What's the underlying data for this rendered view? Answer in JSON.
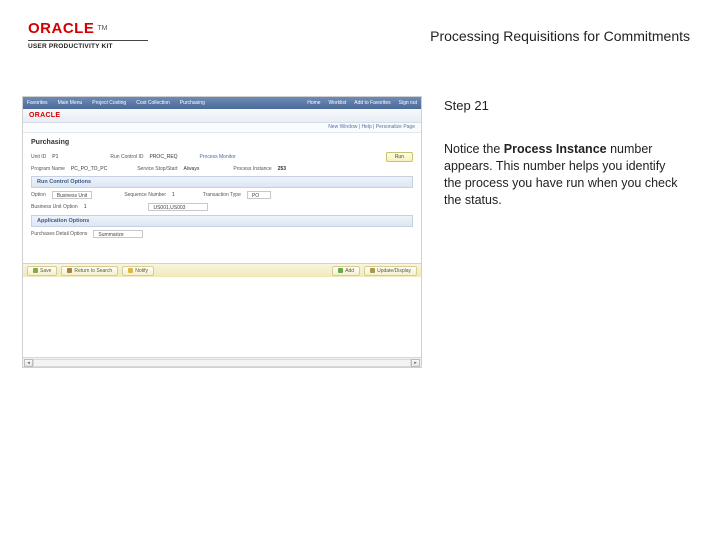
{
  "logo": {
    "brand": "ORACLE",
    "tm": "TM",
    "subtitle": "USER PRODUCTIVITY KIT"
  },
  "page_title": "Processing Requisitions for Commitments",
  "step_label": "Step 21",
  "instruction": {
    "pre": "Notice the ",
    "bold": "Process Instance",
    "post": " number appears. This number helps you identify the process you have run when you check the status."
  },
  "screenshot": {
    "menu": {
      "items": [
        "Favorites",
        "Main Menu",
        "Project Costing",
        "Cost Collection",
        "Purchasing"
      ],
      "right": [
        "Home",
        "Worklist",
        "Add to Favorites",
        "Sign out"
      ]
    },
    "oracle": "ORACLE",
    "crumbs": "New Window | Help | Personalize Page",
    "heading": "Purchasing",
    "row1": {
      "l1": "Unit ID",
      "v1": "P1",
      "l2": "Run Control ID",
      "v2": "PROC_REQ",
      "l3": "Process Monitor",
      "run": "Run"
    },
    "row2": {
      "l1": "Program Name",
      "v1": "PC_PO_TO_PC",
      "l2": "Service Stop/Start",
      "v2": "Always",
      "l3": "Process Instance",
      "v3": "253"
    },
    "group1": "Run Control Options",
    "opts": {
      "l1": "Option",
      "v1": "Business Unit",
      "l2": "Sequence Number",
      "v2": "1",
      "l3": "Transaction Type",
      "v3": "PO"
    },
    "opts2": {
      "l1": "Business Unit Option",
      "v1": "1",
      "l2": "",
      "v2": "US001,US003"
    },
    "group2": "Application Options",
    "app": {
      "l1": "Purchases Detail Options",
      "v1": "Summarize"
    },
    "toolbar": {
      "save": "Save",
      "return": "Return to Search",
      "notify": "Notify",
      "add": "Add",
      "update": "Update/Display"
    }
  }
}
